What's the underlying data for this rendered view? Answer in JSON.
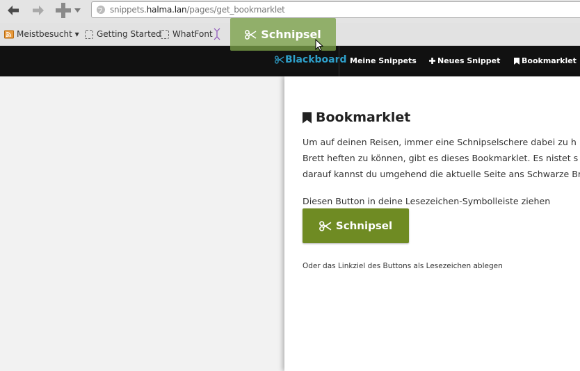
{
  "browser": {
    "url_scheme_host_prefix": "snippets.",
    "url_host_main": "halma.lan",
    "url_path": "/pages/get_bookmarklet",
    "bookmarks": [
      {
        "label": "Meistbesucht ▾",
        "icon": "rss-folder-icon"
      },
      {
        "label": "Getting Started",
        "icon": "page-icon"
      },
      {
        "label": "WhatFont",
        "icon": "page-icon"
      }
    ],
    "dragged_bookmark_label": "Schnipsel"
  },
  "site_nav": {
    "brand": "Blackboard",
    "links": [
      "Meine Snippets",
      "Neues Snippet",
      "Bookmarklet"
    ]
  },
  "card": {
    "title": "Bookmarklet",
    "paragraph_lines": [
      "Um auf deinen Reisen, immer eine Schnipselschere dabei zu h",
      "Brett heften zu können, gibt es dieses Bookmarklet. Es nistet s",
      "darauf kannst du umgehend die aktuelle Seite ans Schwarze Br"
    ],
    "instruction": "Diesen Button in deine Lesezeichen-Symbolleiste ziehen",
    "button_label": "Schnipsel",
    "note": "Oder das Linkziel des Buttons als Lesezeichen ablegen"
  },
  "colors": {
    "brand": "#2e9fc9",
    "button_green": "#6f8b23",
    "nav_bg": "#111111"
  }
}
